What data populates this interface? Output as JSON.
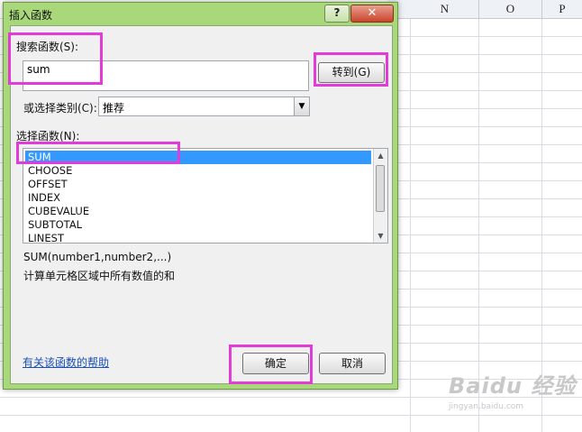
{
  "sheet": {
    "columns": [
      "N",
      "O",
      "P"
    ]
  },
  "dialog": {
    "title": "插入函数",
    "help_glyph": "?",
    "close_glyph": "✕",
    "search_label": "搜索函数(S):",
    "search_value": "sum",
    "goto_button": "转到(G)",
    "category_label": "或选择类别(C):",
    "category_value": "推荐",
    "function_list_label": "选择函数(N):",
    "functions": [
      "SUM",
      "CHOOSE",
      "OFFSET",
      "INDEX",
      "CUBEVALUE",
      "SUBTOTAL",
      "LINEST"
    ],
    "selected_function": "SUM",
    "signature": "SUM(number1,number2,...)",
    "description": "计算单元格区域中所有数值的和",
    "help_link": "有关该函数的帮助",
    "ok_button": "确定",
    "cancel_button": "取消"
  },
  "watermark": {
    "logo": "Baidu 经验",
    "url": "jingyan.baidu.com"
  },
  "colors": {
    "dialog_frame": "#a9d87a",
    "selection": "#3399ff",
    "annotation": "#e23cd8"
  }
}
